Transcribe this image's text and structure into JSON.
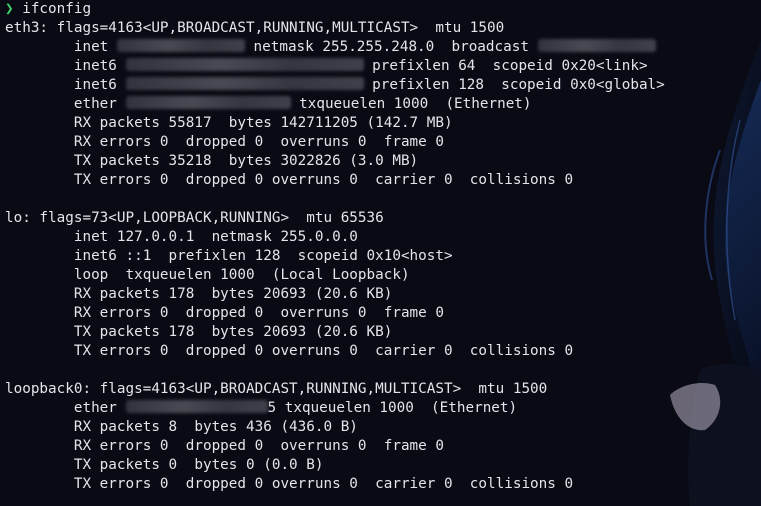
{
  "prompt": {
    "symbol": "❯",
    "command": "ifconfig"
  },
  "blocks": [
    {
      "header": "eth3: flags=4163<UP,BROADCAST,RUNNING,MULTICAST>  mtu 1500",
      "lines": [
        {
          "pre": "        inet ",
          "post": " netmask 255.255.248.0  broadcast "
        },
        {
          "pre": "        inet6 ",
          "post": " prefixlen 64  scopeid 0x20<link>"
        },
        {
          "pre": "        inet6 ",
          "post": " prefixlen 128  scopeid 0x0<global>"
        },
        {
          "pre": "        ether ",
          "post": " txqueuelen 1000  (Ethernet)"
        },
        {
          "text": "        RX packets 55817  bytes 142711205 (142.7 MB)"
        },
        {
          "text": "        RX errors 0  dropped 0  overruns 0  frame 0"
        },
        {
          "text": "        TX packets 35218  bytes 3022826 (3.0 MB)"
        },
        {
          "text": "        TX errors 0  dropped 0 overruns 0  carrier 0  collisions 0"
        }
      ]
    },
    {
      "header": "lo: flags=73<UP,LOOPBACK,RUNNING>  mtu 65536",
      "lines": [
        {
          "text": "        inet 127.0.0.1  netmask 255.0.0.0"
        },
        {
          "text": "        inet6 ::1  prefixlen 128  scopeid 0x10<host>"
        },
        {
          "text": "        loop  txqueuelen 1000  (Local Loopback)"
        },
        {
          "text": "        RX packets 178  bytes 20693 (20.6 KB)"
        },
        {
          "text": "        RX errors 0  dropped 0  overruns 0  frame 0"
        },
        {
          "text": "        TX packets 178  bytes 20693 (20.6 KB)"
        },
        {
          "text": "        TX errors 0  dropped 0 overruns 0  carrier 0  collisions 0"
        }
      ]
    },
    {
      "header": "loopback0: flags=4163<UP,BROADCAST,RUNNING,MULTICAST>  mtu 1500",
      "lines": [
        {
          "pre": "        ether ",
          "post": "5 txqueuelen 1000  (Ethernet)"
        },
        {
          "text": "        RX packets 8  bytes 436 (436.0 B)"
        },
        {
          "text": "        RX errors 0  dropped 0  overruns 0  frame 0"
        },
        {
          "text": "        TX packets 0  bytes 0 (0.0 B)"
        },
        {
          "text": "        TX errors 0  dropped 0 overruns 0  carrier 0  collisions 0"
        }
      ]
    }
  ]
}
